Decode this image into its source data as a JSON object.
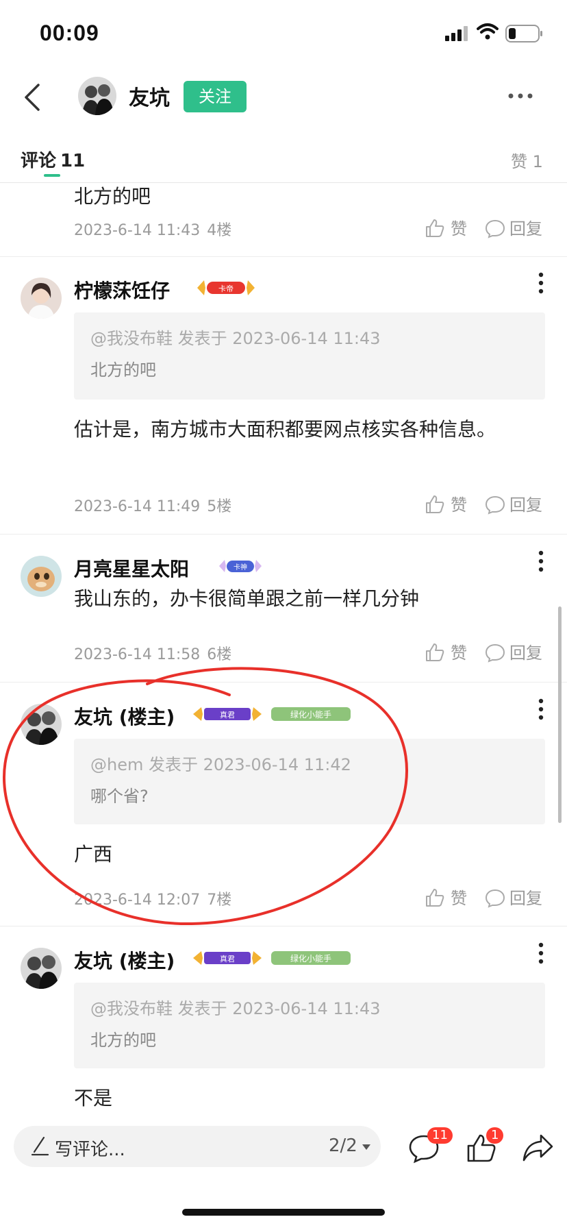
{
  "status_bar": {
    "time": "00:09"
  },
  "header": {
    "user_name": "友坑",
    "follow_label": "关注"
  },
  "tabs": {
    "comments_label": "评论",
    "comments_count": "11",
    "likes_label": "赞 1"
  },
  "actions": {
    "like_label": "赞",
    "reply_label": "回复"
  },
  "comments": [
    {
      "body": "北方的吧",
      "date": "2023-6-14 11:43",
      "floor": "4楼"
    },
    {
      "user": "柠檬莯饪仔",
      "badge": "卡帝",
      "quote_head": "@我没布鞋 发表于 2023-06-14 11:43",
      "quote_text": "北方的吧",
      "body": "估计是，南方城市大面积都要网点核实各种信息。",
      "date": "2023-6-14 11:49",
      "floor": "5楼"
    },
    {
      "user": "月亮星星太阳",
      "badge": "卡神",
      "body": "我山东的，办卡很简单跟之前一样几分钟",
      "date": "2023-6-14 11:58",
      "floor": "6楼"
    },
    {
      "user": "友坑 (楼主)",
      "badge": "真君",
      "badge2": "绿化小能手",
      "quote_head": "@hem 发表于 2023-06-14 11:42",
      "quote_text": "哪个省?",
      "body": "广西",
      "date": "2023-6-14 12:07",
      "floor": "7楼"
    },
    {
      "user": "友坑 (楼主)",
      "badge": "真君",
      "badge2": "绿化小能手",
      "quote_head": "@我没布鞋 发表于 2023-06-14 11:43",
      "quote_text": "北方的吧",
      "body": "不是"
    }
  ],
  "bottom_bar": {
    "placeholder": "写评论...",
    "page_indicator": "2/2",
    "comment_count": "11",
    "like_count": "1"
  },
  "colors": {
    "accent": "#2fbf8b",
    "badge_red": "#ff3b30",
    "annotation": "#e8302a"
  },
  "icons": [
    "back-arrow-icon",
    "more-icon",
    "kebab-icon",
    "thumb-up-icon",
    "comment-bubble-icon",
    "share-icon",
    "pen-icon"
  ]
}
